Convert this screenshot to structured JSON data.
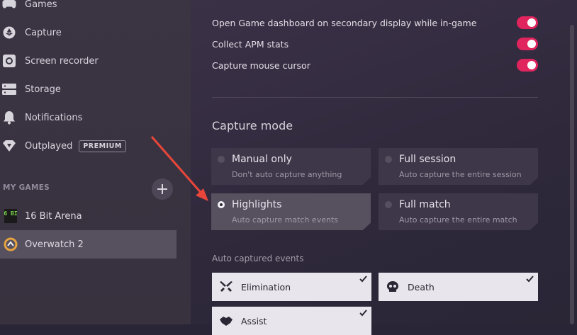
{
  "sidebar": {
    "items": [
      {
        "label": "Games",
        "icon": "gamepad-icon"
      },
      {
        "label": "Capture",
        "icon": "camera-aperture-icon"
      },
      {
        "label": "Screen recorder",
        "icon": "record-icon"
      },
      {
        "label": "Storage",
        "icon": "storage-icon"
      },
      {
        "label": "Notifications",
        "icon": "bell-icon"
      },
      {
        "label": "Outplayed",
        "icon": "outplayed-logo-icon",
        "badge": "PREMIUM"
      }
    ],
    "my_games_title": "MY GAMES",
    "games": [
      {
        "label": "16 Bit Arena",
        "icon": "16-bit-arena-logo-icon",
        "icon_text": "16 BIT"
      },
      {
        "label": "Overwatch 2",
        "icon": "overwatch-logo-icon",
        "active": true
      }
    ]
  },
  "settings": {
    "toggles": [
      {
        "label": "Open Game dashboard on secondary display while in-game",
        "on": true
      },
      {
        "label": "Collect APM stats",
        "on": true
      },
      {
        "label": "Capture mouse cursor",
        "on": true
      }
    ],
    "capture_mode_title": "Capture mode",
    "modes": [
      {
        "title": "Manual only",
        "desc": "Don't auto capture anything",
        "selected": false
      },
      {
        "title": "Full session",
        "desc": "Auto capture the entire session",
        "selected": false
      },
      {
        "title": "Highlights",
        "desc": "Auto capture match events",
        "selected": true
      },
      {
        "title": "Full match",
        "desc": "Auto capture the entire match",
        "selected": false
      }
    ],
    "events_title": "Auto captured events",
    "events": [
      {
        "label": "Elimination",
        "icon": "crossed-swords-icon",
        "checked": true
      },
      {
        "label": "Death",
        "icon": "skull-icon",
        "checked": true
      },
      {
        "label": "Assist",
        "icon": "handshake-icon",
        "checked": true
      }
    ]
  },
  "colors": {
    "accent": "#e0245e",
    "annotation_arrow": "#e8463a"
  }
}
